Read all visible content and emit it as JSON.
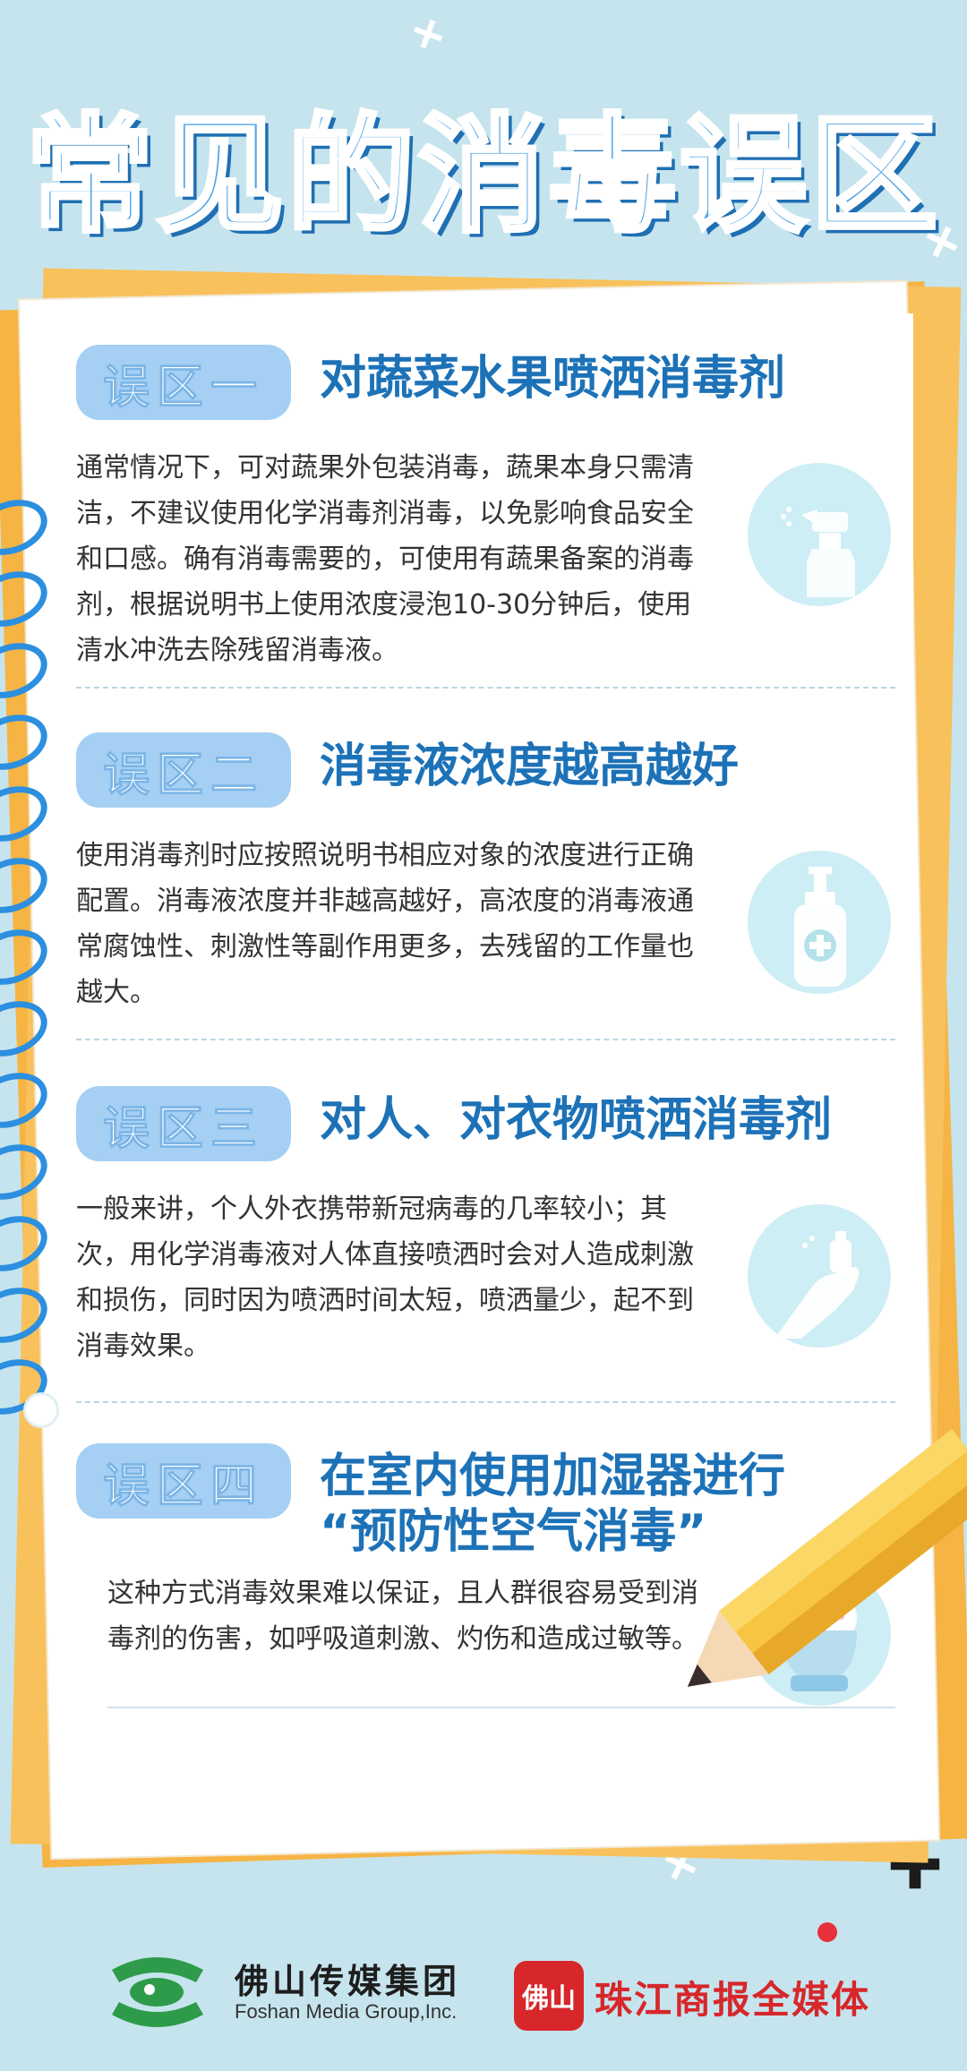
{
  "title": "常见的消毒误区",
  "sections": [
    {
      "tag": "误区一",
      "heading": "对蔬菜水果喷洒消毒剂",
      "lines": [
        "通常情况下，可对蔬果外包装消毒，蔬果本身只需清",
        "洁，不建议使用化学消毒剂消毒，以免影响食品安全",
        "和口感。确有消毒需要的，可使用有蔬果备案的消毒",
        "剂，根据说明书上使用浓度浸泡10-30分钟后，使用",
        "清水冲洗去除残留消毒液。"
      ],
      "icon": "spray-bottle-icon"
    },
    {
      "tag": "误区二",
      "heading": "消毒液浓度越高越好",
      "lines": [
        "使用消毒剂时应按照说明书相应对象的浓度进行正确",
        "配置。消毒液浓度并非越高越好，高浓度的消毒液通",
        "常腐蚀性、刺激性等副作用更多，去残留的工作量也",
        "越大。"
      ],
      "icon": "pump-bottle-icon"
    },
    {
      "tag": "误区三",
      "heading": "对人、对衣物喷洒消毒剂",
      "lines": [
        "一般来讲，个人外衣携带新冠病毒的几率较小；其",
        "次，用化学消毒液对人体直接喷洒时会对人造成刺激",
        "和损伤，同时因为喷洒时间太短，喷洒量少，起不到",
        "消毒效果。"
      ],
      "icon": "hand-spray-icon"
    },
    {
      "tag": "误区四",
      "heading_lines": [
        "在室内使用加湿器进行",
        "“预防性空气消毒”"
      ],
      "lines": [
        "这种方式消毒效果难以保证，且人群很容易受到消",
        "毒剂的伤害，如呼吸道刺激、灼伤和造成过敏等。"
      ],
      "icon": "humidifier-icon"
    }
  ],
  "footer": {
    "foshan_name": "佛山传媒集团",
    "foshan_english": "Foshan Media Group,Inc.",
    "zj_badge": "佛山",
    "zj_name": "珠江商报全媒体"
  },
  "colors": {
    "background": "#c6e4ee",
    "title": "#4ea3e5",
    "heading": "#1d72b7",
    "tag": "#a5cff3",
    "paper_edge": "#f6b445",
    "accent_red": "#d7272b"
  }
}
